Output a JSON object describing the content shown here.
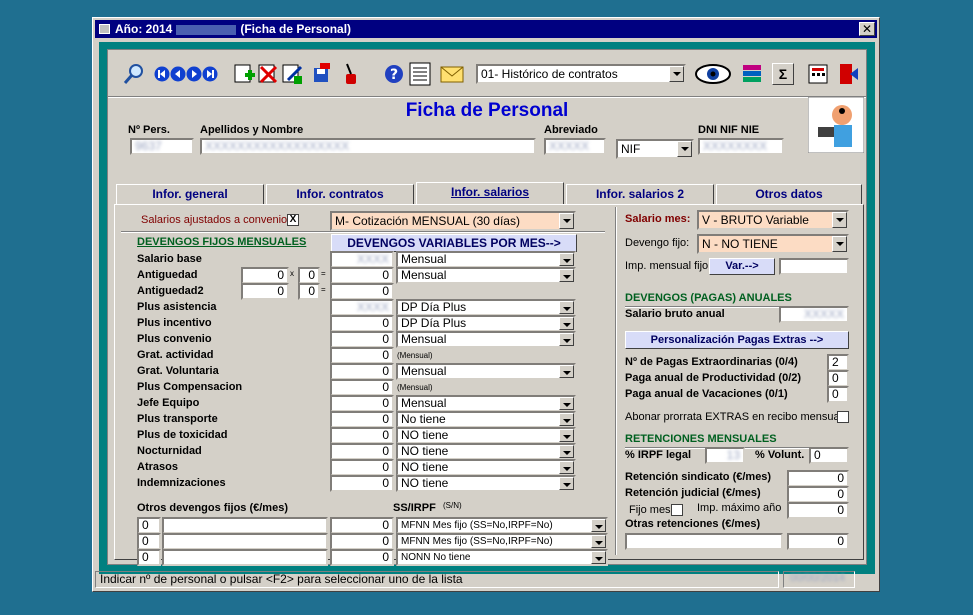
{
  "window": {
    "title_prefix": "Año: 2014",
    "title_suffix": "(Ficha de Personal)",
    "close_label": "✕"
  },
  "toolbar": {
    "view_select": "01- Histórico de contratos",
    "sigma_label": "Σ",
    "icons": [
      "search-icon",
      "first-record-icon",
      "prev-record-icon",
      "next-record-icon",
      "last-record-icon",
      "new-record-icon",
      "delete-record-icon",
      "edit-record-icon",
      "save-record-icon",
      "tool-icon",
      "help-icon",
      "print-icon",
      "mail-icon",
      "view-eye-icon",
      "books-icon",
      "sum-icon",
      "calculator-icon",
      "exit-door-icon"
    ]
  },
  "header": {
    "title": "Ficha de Personal",
    "labels": {
      "num": "Nº Pers.",
      "name": "Apellidos y Nombre",
      "abbr": "Abreviado",
      "dni": "DNI NIF NIE"
    },
    "doc_type": "NIF"
  },
  "tabs": [
    "Infor. general",
    "Infor. contratos",
    "Infor. salarios",
    "Infor. salarios 2",
    "Otros datos"
  ],
  "left": {
    "convenio_label": "Salarios ajustados a convenio",
    "convenio_check": "X",
    "cotizacion": "M- Cotización MENSUAL (30 días)",
    "devengos_fijos": "DEVENGOS FIJOS MENSUALES",
    "devengos_var_btn": "DEVENGOS VARIABLES POR MES-->",
    "rows": [
      {
        "label": "Salario base",
        "value": "",
        "period": "Mensual"
      },
      {
        "label": "Antiguedad",
        "value": "0",
        "period": "Mensual"
      },
      {
        "label": "Antiguedad2",
        "value": "0",
        "period": ""
      },
      {
        "label": "Plus asistencia",
        "value": "",
        "period": "DP Día Plus"
      },
      {
        "label": "Plus incentivo",
        "value": "0",
        "period": "DP Día Plus"
      },
      {
        "label": "Plus convenio",
        "value": "0",
        "period": "Mensual"
      },
      {
        "label": "Grat. actividad",
        "value": "0",
        "period": "(Mensual)"
      },
      {
        "label": "Grat. Voluntaria",
        "value": "0",
        "period": "Mensual"
      },
      {
        "label": "Plus Compensacion",
        "value": "0",
        "period": "(Mensual)"
      },
      {
        "label": "Jefe Equipo",
        "value": "0",
        "period": "Mensual"
      },
      {
        "label": "Plus transporte",
        "value": "0",
        "period": "No tiene"
      },
      {
        "label": "Plus de toxicidad",
        "value": "0",
        "period": "NO tiene"
      },
      {
        "label": "Nocturnidad",
        "value": "0",
        "period": "NO tiene"
      },
      {
        "label": "Atrasos",
        "value": "0",
        "period": "NO tiene"
      },
      {
        "label": "Indemnizaciones",
        "value": "0",
        "period": "NO tiene"
      }
    ],
    "antig_a": "0",
    "antig_b": "0",
    "antig2_a": "0",
    "antig2_b": "0",
    "mult": "x",
    "eq": "=",
    "otros_label": "Otros devengos fijos (€/mes)",
    "ssirpf_label": "SS/IRPF",
    "ssirpf_hint": "(S/N)",
    "otros": [
      {
        "code": "0",
        "value": "0",
        "type": "MFNN Mes fijo (SS=No,IRPF=No)"
      },
      {
        "code": "0",
        "value": "0",
        "type": "MFNN Mes fijo (SS=No,IRPF=No)"
      },
      {
        "code": "0",
        "value": "0",
        "type": "NONN No tiene"
      }
    ]
  },
  "right": {
    "salario_mes_label": "Salario mes:",
    "salario_mes": "V - BRUTO Variable",
    "devengo_fijo_label": "Devengo fijo:",
    "devengo_fijo": "N - NO TIENE",
    "imp_mensual_label": "Imp. mensual fijo",
    "var_btn": "Var.-->",
    "pagas_title": "DEVENGOS (PAGAS) ANUALES",
    "bruto_anual_label": "Salario bruto anual",
    "pagas_btn": "Personalización Pagas Extras -->",
    "pagas_extra_label": "Nº de Pagas Extraordinarias (0/4)",
    "pagas_extra": "2",
    "productividad_label": "Paga anual de Productividad (0/2)",
    "productividad": "0",
    "vacaciones_label": "Paga anual de Vacaciones     (0/1)",
    "vacaciones": "0",
    "prorrata_label": "Abonar prorrata EXTRAS en recibo mensual",
    "ret_title": "RETENCIONES  MENSUALES",
    "irpf_label": "%  IRPF legal",
    "volunt_label": "% Volunt.",
    "volunt": "0",
    "sindicato_label": "Retención sindicato (€/mes)",
    "sindicato": "0",
    "judicial_label": "Retención judicial (€/mes)",
    "judicial": "0",
    "fijo_mes_label": "Fijo mes",
    "imp_max_label": "Imp. máximo año",
    "imp_max": "0",
    "otras_label": "Otras retenciones (€/mes)",
    "otras": "0"
  },
  "status": {
    "text": "Indicar nº de personal o pulsar <F2> para seleccionar uno de la lista"
  }
}
